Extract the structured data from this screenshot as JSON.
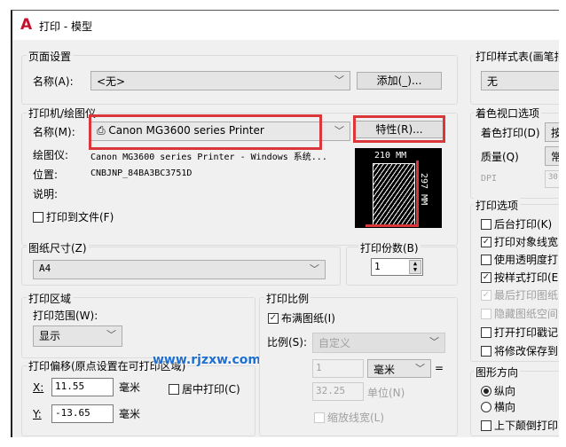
{
  "window": {
    "title": "打印 - 模型",
    "icon": "autocad-logo-icon"
  },
  "page_setup": {
    "group": "页面设置",
    "name_label": "名称(A):",
    "name_value": "<无>",
    "add_button": "添加(_)..."
  },
  "printer": {
    "group": "打印机/绘图仪",
    "name_label": "名称(M):",
    "name_value": "Canon MG3600 series Printer",
    "properties_button": "特性(R)...",
    "plotter_label": "绘图仪:",
    "plotter_value": "Canon MG3600 series Printer - Windows 系统...",
    "location_label": "位置:",
    "location_value": "CNBJNP_84BA3BC3751D",
    "description_label": "说明:",
    "print_to_file": "打印到文件(F)",
    "preview_width": "210 MM",
    "preview_height": "297 MM"
  },
  "paper_size": {
    "group": "图纸尺寸(Z)",
    "value": "A4"
  },
  "copies": {
    "group": "打印份数(B)",
    "value": "1"
  },
  "plot_area": {
    "group": "打印区域",
    "what_label": "打印范围(W):",
    "what_value": "显示"
  },
  "offset": {
    "group": "打印偏移(原点设置在可打印区域)",
    "x_label": "X:",
    "x_value": "11.55",
    "x_unit": "毫米",
    "y_label": "Y:",
    "y_value": "-13.65",
    "y_unit": "毫米",
    "center": "居中打印(C)"
  },
  "scale": {
    "group": "打印比例",
    "fit": "布满图纸(I)",
    "scale_label": "比例(S):",
    "scale_value": "自定义",
    "num": "1",
    "unit": "毫米",
    "equals": "=",
    "den": "32.25",
    "den_unit": "单位(N)",
    "lineweights": "缩放线宽(L)"
  },
  "style_table": {
    "group": "打印样式表(画笔指",
    "value": "无"
  },
  "shaded": {
    "group": "着色视口选项",
    "shade_label": "着色打印(D)",
    "shade_value": "按",
    "quality_label": "质量(Q)",
    "quality_value": "常",
    "dpi_label": "DPI",
    "dpi_value": "30"
  },
  "options": {
    "group": "打印选项",
    "items": [
      {
        "label": "后台打印(K)",
        "checked": false,
        "disabled": false
      },
      {
        "label": "打印对象线宽",
        "checked": true,
        "disabled": false
      },
      {
        "label": "使用透明度打",
        "checked": false,
        "disabled": false
      },
      {
        "label": "按样式打印(E",
        "checked": true,
        "disabled": false
      },
      {
        "label": "最后打印图纸",
        "checked": true,
        "disabled": true
      },
      {
        "label": "隐藏图纸空间",
        "checked": false,
        "disabled": true
      },
      {
        "label": "打开打印戳记",
        "checked": false,
        "disabled": false
      },
      {
        "label": "将修改保存到",
        "checked": false,
        "disabled": false
      }
    ]
  },
  "orientation": {
    "group": "图形方向",
    "portrait": "纵向",
    "landscape": "横向",
    "upside_down": "上下颠倒打印"
  },
  "watermark": "www.rjzxw.com",
  "colors": {
    "highlight": "#d9373a",
    "accent": "#1e6fd0"
  }
}
